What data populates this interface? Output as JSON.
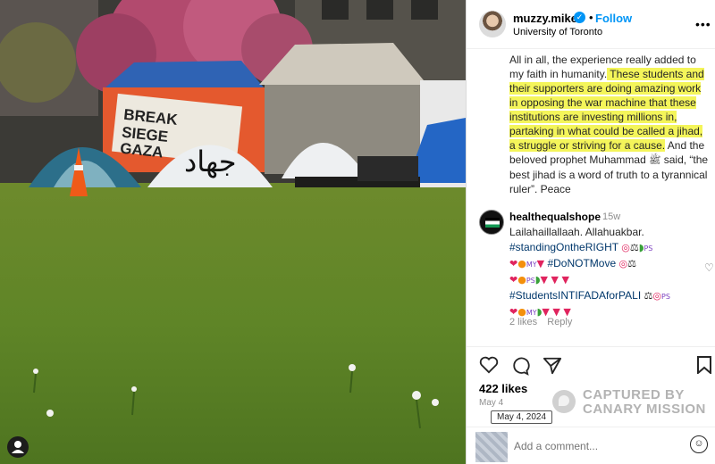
{
  "header": {
    "username": "muzzy.mike",
    "follow_label": "Follow",
    "location": "University of Toronto",
    "more_icon": "more-horizontal-icon"
  },
  "photo": {
    "description_icon": "user-tag-icon",
    "banner_text": "BREAK SIEGE GAZA",
    "tent_text": "جهاد"
  },
  "caption": {
    "lines": [
      "All in all, the experience really added to my faith in humanity.",
      " These students and their supporters are doing amazing work in opposing the war machine that these institutions are investing millions in, partaking in what could be called a jihad, a struggle or striving for a cause.",
      " And the beloved prophet Muhammad ",
      "ﷺ",
      " said, “the best jihad is a word of truth to a tyrannical ruler”. Peace"
    ],
    "highlight_color": "#f4f55a"
  },
  "comment": {
    "username": "healthequalshope",
    "time": "15w",
    "line1": "Lailahaillallaah. Allahuakbar.",
    "tag1": "#standingOntheRIGHT",
    "tag2": "#DoNOTMove",
    "tag3": "#StudentsINTIFADAforPALI",
    "likes": "2 likes",
    "reply": "Reply",
    "ps_label": "PS",
    "my_label": "MY"
  },
  "actions": {
    "like_icon": "heart-icon",
    "comment_icon": "comment-icon",
    "share_icon": "share-icon",
    "save_icon": "bookmark-icon"
  },
  "likes_count": "422 likes",
  "date_short": "May 4",
  "date_tooltip": "May 4, 2024",
  "watermark": {
    "line1": "CAPTURED BY",
    "line2": "CANARY MISSION"
  },
  "add_comment": {
    "placeholder": "Add a comment...",
    "emoji_icon": "smiley-icon"
  },
  "colors": {
    "accent": "#0095f6",
    "hashtag": "#00376b",
    "muted": "#8e8e8e"
  }
}
